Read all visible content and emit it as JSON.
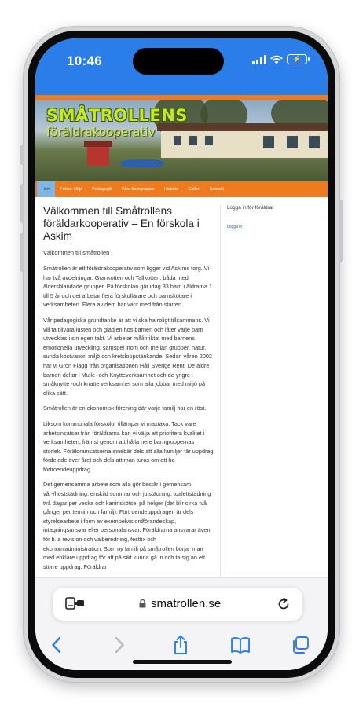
{
  "status": {
    "time": "10:46",
    "battery_level": 0.6
  },
  "site": {
    "logo_main": "SMÅTROLLENS",
    "logo_sub": "föräldrakooperativ",
    "nav": [
      "Hem",
      "Fokus: Miljö",
      "Pedagogik",
      "Våra barngrupper",
      "Historia",
      "Galleri",
      "Kontakt"
    ],
    "nav_active_index": 0,
    "title": "Välkommen till Småtrollens föräldarkooperativ – En förskola i Askim",
    "subtitle": "Välkommen till småtrollen",
    "paragraphs": [
      "Småtrollen är ett föräldrakooperativ som ligger vid Askims torg. Vi har två avdelningar, Grankotten och Tallkotten, båda med åldersblandade grupper. På förskolan går idag 33 barn i åldrarna 1 till 5 år och det arbetar flera förskollärare och barnskötare i verksamheten. Flera av dem har varit med från starten.",
      "Vår pedagogiska grundtanke är att vi ska ha roligt tillsammans. Vi vill ta tillvara lusten och glädjen hos barnen och låter varje barn utvecklas i sin egen takt. Vi arbetar målinriktat med barnens emotionella utveckling, samspel inom och mellan grupper, natur, sunda kostvanor, miljö och kretsloppstänkande. Sedan våren 2002 har vi Grön Flagg från organisationen Håll Sverige Rent. De äldre barnen deltar i Mulle- och Knytteverksamhet och de yngre i småknytte -och knatte verksamhet som alla jobbar med miljö på olika sätt.",
      "Småtrollen är en ekonomisk förening där varje familj har en röst.",
      "Liksom kommunala förskolor tillämpar vi maxtaxa. Tack vare arbetsinsatser från föräldrarna kan vi välja att prioritera kvalitet i verksamheten, främst genom att hålla nere barngruppernas storlek. Föräldrainsatserna innebär dels att alla familjer får uppdrag fördelade över året och dels att man turas om att ha förtroendeuppdrag.",
      "Det gemensamma arbete som alla gör består i gemensam vår-/höststädning, enskild sommar och julstädning, toalettstädning två dagar per vecka och kaninskötsel på helger (det blir cirka två gånger per termin och familj). Förtroendeuppdragen är dels styrelsearbete i form av exempelvis ordförandeskap, intagningsansvar eller personalansvar. Föräldrarna ansvarar även för b.la revision och valberedning, festfix och ekonomiadministration. Som ny familj på småtrollen börjar man med enklare uppdrag för att på sikt kunna gå in och ta sig an ett större uppdrag. Föräldrar"
    ],
    "sidebar_title": "Logga in för föräldrar",
    "sidebar_link": "Logga in"
  },
  "browser": {
    "url": "smatrollen.se"
  },
  "icons": {
    "tabs": "tabs-overview-icon",
    "lock": "lock-icon",
    "reload": "reload-icon",
    "back": "back-chevron-icon",
    "forward": "forward-chevron-icon",
    "share": "share-icon",
    "bookmarks": "bookmarks-icon",
    "all_tabs": "tabs-icon"
  },
  "colors": {
    "accent_blue": "#2b7de9",
    "site_orange": "#f07a1e",
    "nav_active": "#7fb6e6"
  }
}
